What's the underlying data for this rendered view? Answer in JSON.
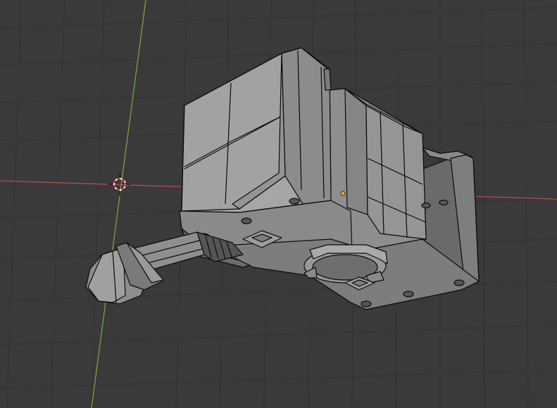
{
  "viewport": {
    "background": "#3a3a3a",
    "grid_color": "#313131",
    "x_axis_color": "#b4485a",
    "y_axis_color": "#7ba23a",
    "mesh_face_color": "#9a9a9a",
    "mesh_shadow_color": "#5e5e5e",
    "mesh_edge_color": "#0b0b0b",
    "origin_color": "#f0a030"
  },
  "scene": {
    "object_type": "mesh",
    "shading": "solid",
    "wireframe_overlay": true,
    "selected_object_origin_visible": true,
    "cursor_3d_visible": true
  }
}
